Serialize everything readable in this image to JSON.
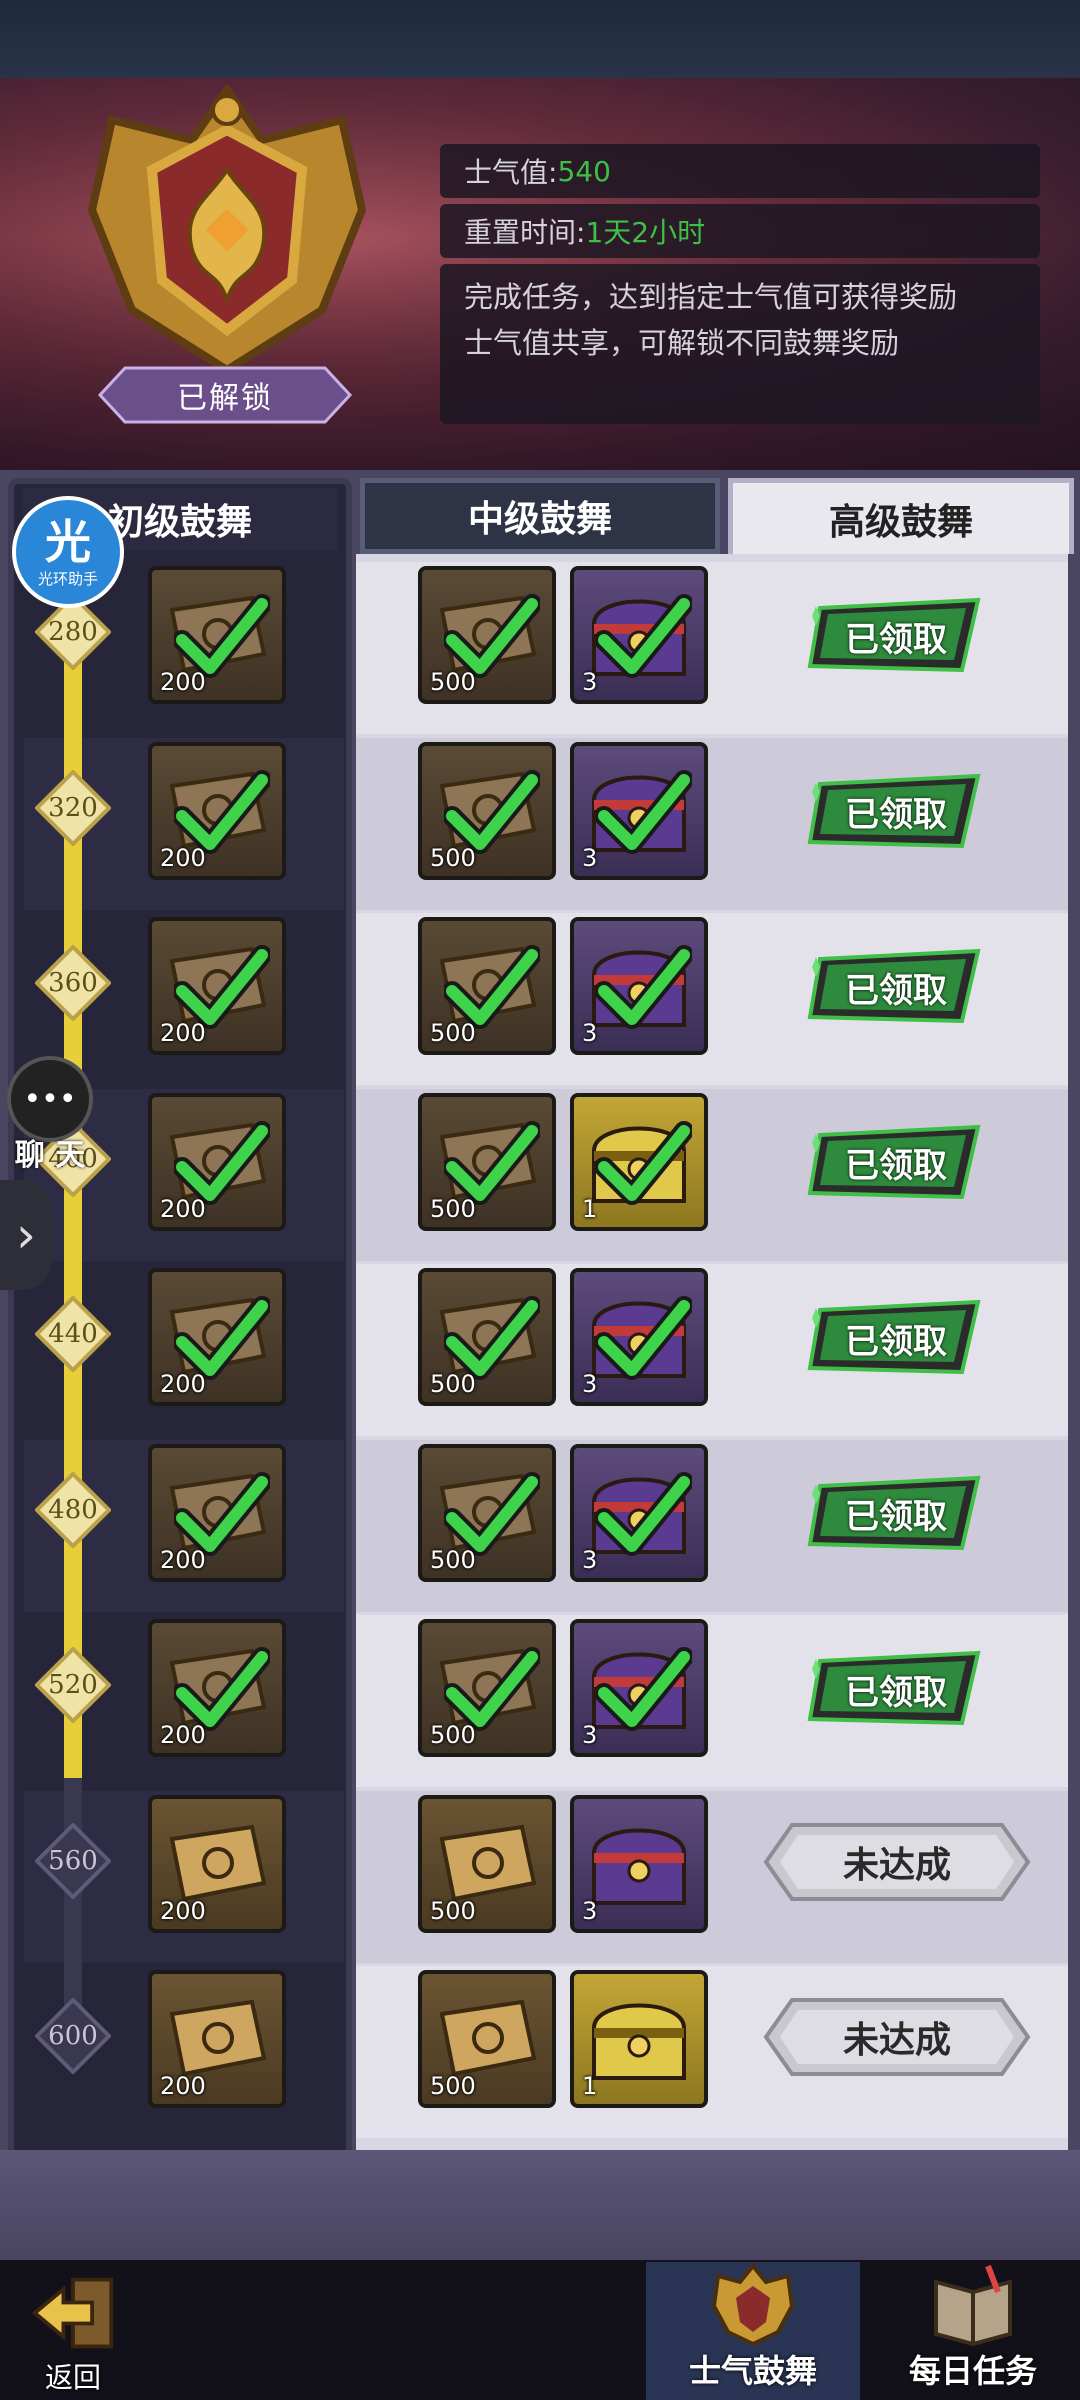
{
  "header": {
    "status_badge": "已解锁",
    "morale_label": "士气值:",
    "morale_value": "540",
    "reset_label": "重置时间:",
    "reset_value": "1天2小时",
    "description_line1": "完成任务，达到指定士气值可获得奖励",
    "description_line2": "士气值共享，可解锁不同鼓舞奖励"
  },
  "tabs": {
    "basic": "初级鼓舞",
    "mid": "中级鼓舞",
    "high": "高级鼓舞",
    "active": "高级鼓舞"
  },
  "overlay": {
    "halo_big": "光",
    "halo_small": "光环助手",
    "chat_label": "聊 天"
  },
  "tiers": [
    {
      "threshold": "280",
      "basic_qty": "200",
      "high_ticket_qty": "500",
      "high_chest_qty": "3",
      "chest": "purple",
      "status": "已领取",
      "claimed": true
    },
    {
      "threshold": "320",
      "basic_qty": "200",
      "high_ticket_qty": "500",
      "high_chest_qty": "3",
      "chest": "purple",
      "status": "已领取",
      "claimed": true
    },
    {
      "threshold": "360",
      "basic_qty": "200",
      "high_ticket_qty": "500",
      "high_chest_qty": "3",
      "chest": "purple",
      "status": "已领取",
      "claimed": true
    },
    {
      "threshold": "400",
      "basic_qty": "200",
      "high_ticket_qty": "500",
      "high_chest_qty": "1",
      "chest": "gold",
      "status": "已领取",
      "claimed": true
    },
    {
      "threshold": "440",
      "basic_qty": "200",
      "high_ticket_qty": "500",
      "high_chest_qty": "3",
      "chest": "purple",
      "status": "已领取",
      "claimed": true
    },
    {
      "threshold": "480",
      "basic_qty": "200",
      "high_ticket_qty": "500",
      "high_chest_qty": "3",
      "chest": "purple",
      "status": "已领取",
      "claimed": true
    },
    {
      "threshold": "520",
      "basic_qty": "200",
      "high_ticket_qty": "500",
      "high_chest_qty": "3",
      "chest": "purple",
      "status": "已领取",
      "claimed": true
    },
    {
      "threshold": "560",
      "basic_qty": "200",
      "high_ticket_qty": "500",
      "high_chest_qty": "3",
      "chest": "purple",
      "status": "未达成",
      "claimed": false
    },
    {
      "threshold": "600",
      "basic_qty": "200",
      "high_ticket_qty": "500",
      "high_chest_qty": "1",
      "chest": "gold",
      "status": "未达成",
      "claimed": false
    }
  ],
  "bottom_nav": {
    "back_label": "返回",
    "morale_tab": "士气鼓舞",
    "daily_tab": "每日任务"
  },
  "colors": {
    "progress_fill": "#e8cf3a",
    "claimed_green": "#3fbf47",
    "active_tab_bg": "#e9e8ef"
  }
}
